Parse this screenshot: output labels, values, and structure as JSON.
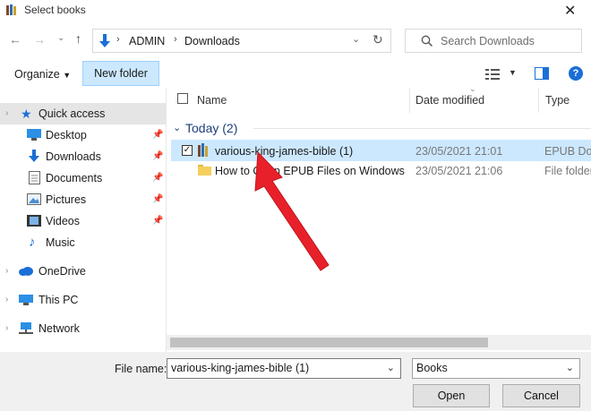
{
  "window": {
    "title": "Select books",
    "close_glyph": "✕"
  },
  "nav": {
    "breadcrumb": [
      "ADMIN",
      "Downloads"
    ],
    "search_placeholder": "Search Downloads"
  },
  "toolbar": {
    "organize_label": "Organize",
    "new_folder_label": "New folder",
    "help_label": "?"
  },
  "sidebar": {
    "quick_access": "Quick access",
    "items": [
      {
        "label": "Desktop",
        "pinned": true
      },
      {
        "label": "Downloads",
        "pinned": true
      },
      {
        "label": "Documents",
        "pinned": true
      },
      {
        "label": "Pictures",
        "pinned": true
      },
      {
        "label": "Videos",
        "pinned": true
      },
      {
        "label": "Music",
        "pinned": false
      }
    ],
    "onedrive": "OneDrive",
    "thispc": "This PC",
    "network": "Network"
  },
  "content": {
    "columns": {
      "name": "Name",
      "date": "Date modified",
      "type": "Type"
    },
    "group_label": "Today (2)",
    "rows": [
      {
        "name": "various-king-james-bible (1)",
        "date": "23/05/2021 21:01",
        "type": "EPUB Doc"
      },
      {
        "name": "How to Open EPUB Files on Windows",
        "date": "23/05/2021 21:06",
        "type": "File folder"
      }
    ]
  },
  "footer": {
    "file_name_label": "File name:",
    "file_name_value": "various-king-james-bible (1)",
    "file_type_value": "Books",
    "open_label": "Open",
    "cancel_label": "Cancel"
  },
  "annotation": {
    "arrow_color": "#e8202a"
  },
  "colors": {
    "selection": "#cce8ff",
    "accent_blue": "#1a6fd6"
  }
}
